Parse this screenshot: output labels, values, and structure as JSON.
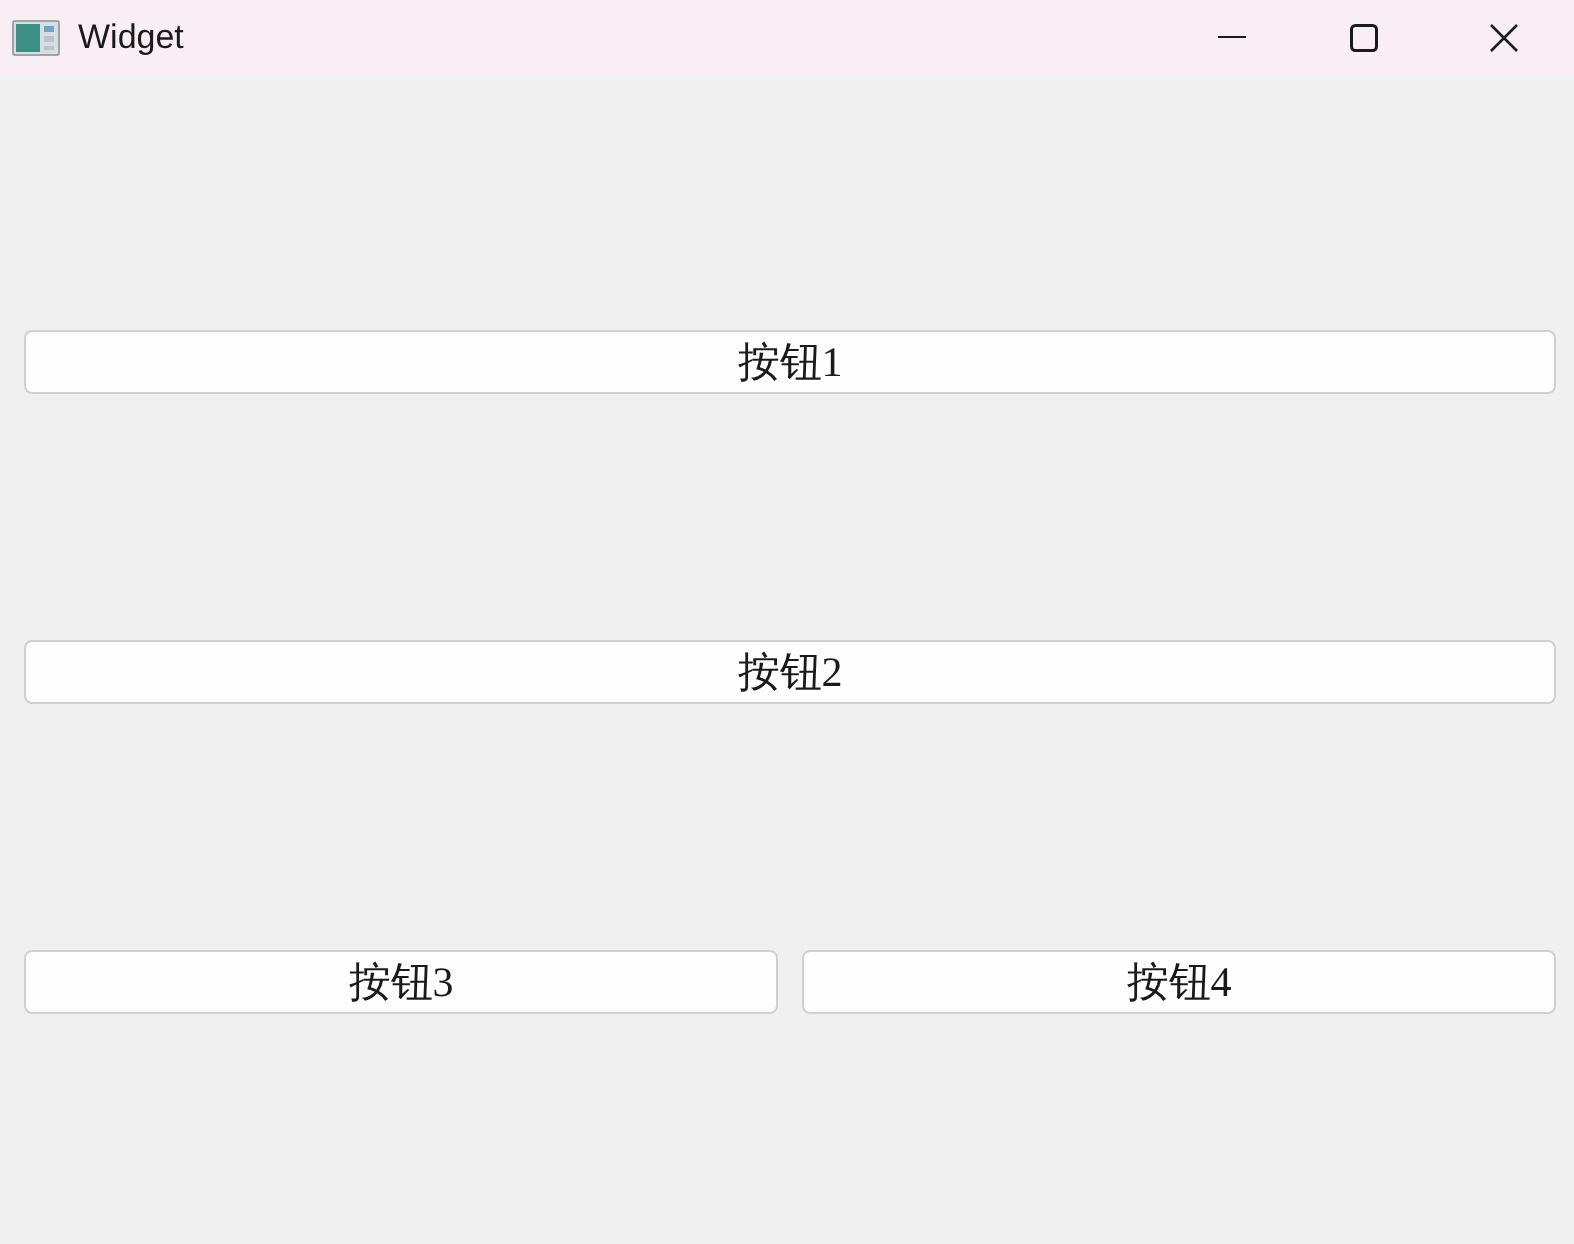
{
  "window": {
    "title": "Widget"
  },
  "rows": [
    {
      "buttons": [
        {
          "label": "按钮1"
        }
      ]
    },
    {
      "buttons": [
        {
          "label": "按钮2"
        }
      ]
    },
    {
      "buttons": [
        {
          "label": "按钮3"
        },
        {
          "label": "按钮4"
        }
      ]
    }
  ]
}
